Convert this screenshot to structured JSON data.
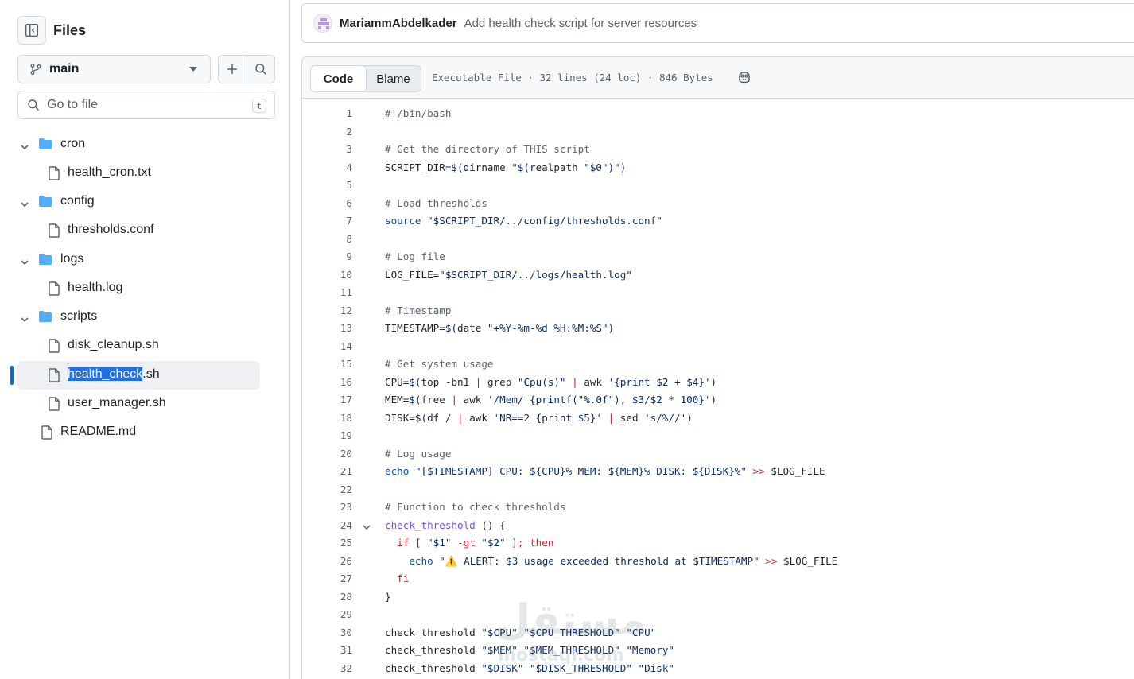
{
  "sidebar": {
    "title": "Files",
    "branch": "main",
    "search_placeholder": "Go to file",
    "search_shortcut": "t",
    "tree": [
      {
        "label": "cron",
        "type": "folder",
        "depth": 0,
        "expanded": true
      },
      {
        "label": "health_cron.txt",
        "type": "file",
        "depth": 1
      },
      {
        "label": "config",
        "type": "folder",
        "depth": 0,
        "expanded": true
      },
      {
        "label": "thresholds.conf",
        "type": "file",
        "depth": 1
      },
      {
        "label": "logs",
        "type": "folder",
        "depth": 0,
        "expanded": true
      },
      {
        "label": "health.log",
        "type": "file",
        "depth": 1
      },
      {
        "label": "scripts",
        "type": "folder",
        "depth": 0,
        "expanded": true
      },
      {
        "label": "disk_cleanup.sh",
        "type": "file",
        "depth": 1
      },
      {
        "label": "health_check.sh",
        "type": "file",
        "depth": 1,
        "active": true,
        "selected_part": "health_check",
        "rest_part": ".sh"
      },
      {
        "label": "user_manager.sh",
        "type": "file",
        "depth": 1
      },
      {
        "label": "README.md",
        "type": "file",
        "depth": 0
      }
    ]
  },
  "commit": {
    "author": "MariammAbdelkader",
    "message": "Add health check script for server resources"
  },
  "file": {
    "tabs": [
      "Code",
      "Blame"
    ],
    "active_tab": "Code",
    "meta": "Executable File · 32 lines (24 loc) · 846 Bytes",
    "copilot_icon": "copilot-icon",
    "lines": [
      [
        [
          "c-cm",
          "#!/bin/bash"
        ]
      ],
      [],
      [
        [
          "c-cm",
          "# Get the directory of THIS script"
        ]
      ],
      [
        [
          "",
          "SCRIPT_DIR="
        ],
        [
          "c-st",
          "$("
        ],
        [
          "",
          "dirname "
        ],
        [
          "c-st",
          "\"$("
        ],
        [
          "",
          "realpath "
        ],
        [
          "c-st",
          "\"$0\""
        ],
        [
          "c-st",
          ")\")"
        ]
      ],
      [],
      [
        [
          "c-cm",
          "# Load thresholds"
        ]
      ],
      [
        [
          "c-bi",
          "source"
        ],
        [
          "",
          " "
        ],
        [
          "c-st",
          "\"$SCRIPT_DIR/../config/thresholds.conf\""
        ]
      ],
      [],
      [
        [
          "c-cm",
          "# Log file"
        ]
      ],
      [
        [
          "",
          "LOG_FILE="
        ],
        [
          "c-st",
          "\"$SCRIPT_DIR/../logs/health.log\""
        ]
      ],
      [],
      [
        [
          "c-cm",
          "# Timestamp"
        ]
      ],
      [
        [
          "",
          "TIMESTAMP="
        ],
        [
          "c-st",
          "$("
        ],
        [
          "",
          "date "
        ],
        [
          "c-st",
          "\"+%Y-%m-%d %H:%M:%S\""
        ],
        [
          "c-st",
          ")"
        ]
      ],
      [],
      [
        [
          "c-cm",
          "# Get system usage"
        ]
      ],
      [
        [
          "",
          "CPU="
        ],
        [
          "c-st",
          "$("
        ],
        [
          "",
          "top -bn1 "
        ],
        [
          "c-kw",
          "|"
        ],
        [
          "",
          " grep "
        ],
        [
          "c-st",
          "\"Cpu(s)\""
        ],
        [
          "",
          " "
        ],
        [
          "c-kw",
          "|"
        ],
        [
          "",
          " awk "
        ],
        [
          "c-st",
          "'{print $2 + $4}'"
        ],
        [
          "c-st",
          ")"
        ]
      ],
      [
        [
          "",
          "MEM="
        ],
        [
          "c-st",
          "$("
        ],
        [
          "",
          "free "
        ],
        [
          "c-kw",
          "|"
        ],
        [
          "",
          " awk "
        ],
        [
          "c-st",
          "'/Mem/ {printf(\"%.0f\"), $3/$2 * 100}'"
        ],
        [
          "c-st",
          ")"
        ]
      ],
      [
        [
          "",
          "DISK="
        ],
        [
          "c-st",
          "$("
        ],
        [
          "",
          "df / "
        ],
        [
          "c-kw",
          "|"
        ],
        [
          "",
          " awk "
        ],
        [
          "c-st",
          "'NR==2 {print $5}'"
        ],
        [
          "",
          " "
        ],
        [
          "c-kw",
          "|"
        ],
        [
          "",
          " sed "
        ],
        [
          "c-st",
          "'s/%//'"
        ],
        [
          "c-st",
          ")"
        ]
      ],
      [],
      [
        [
          "c-cm",
          "# Log usage"
        ]
      ],
      [
        [
          "c-bi",
          "echo"
        ],
        [
          "",
          " "
        ],
        [
          "c-st",
          "\"[$TIMESTAMP] CPU: ${CPU}% MEM: ${MEM}% DISK: ${DISK}%\""
        ],
        [
          "",
          " "
        ],
        [
          "c-kw",
          ">>"
        ],
        [
          "",
          " $LOG_FILE"
        ]
      ],
      [],
      [
        [
          "c-cm",
          "# Function to check thresholds"
        ]
      ],
      [
        [
          "c-fn",
          "check_threshold"
        ],
        [
          "",
          " () {"
        ]
      ],
      [
        [
          "",
          "  "
        ],
        [
          "c-kw",
          "if"
        ],
        [
          "",
          " [ "
        ],
        [
          "c-st",
          "\"$1\""
        ],
        [
          "",
          " "
        ],
        [
          "c-kw",
          "-gt"
        ],
        [
          "",
          " "
        ],
        [
          "c-st",
          "\"$2\""
        ],
        [
          "",
          " ]"
        ],
        [
          "c-kw",
          ";"
        ],
        [
          "",
          " "
        ],
        [
          "c-kw",
          "then"
        ]
      ],
      [
        [
          "",
          "    "
        ],
        [
          "c-bi",
          "echo"
        ],
        [
          "",
          " "
        ],
        [
          "c-st",
          "\"⚠️ ALERT: $3 usage exceeded threshold at $TIMESTAMP\""
        ],
        [
          "",
          " "
        ],
        [
          "c-kw",
          ">>"
        ],
        [
          "",
          " $LOG_FILE"
        ]
      ],
      [
        [
          "",
          "  "
        ],
        [
          "c-kw",
          "fi"
        ]
      ],
      [
        [
          "",
          "}"
        ]
      ],
      [],
      [
        [
          "",
          "check_threshold "
        ],
        [
          "c-st",
          "\"$CPU\""
        ],
        [
          "",
          " "
        ],
        [
          "c-st",
          "\"$CPU_THRESHOLD\""
        ],
        [
          "",
          " "
        ],
        [
          "c-st",
          "\"CPU\""
        ]
      ],
      [
        [
          "",
          "check_threshold "
        ],
        [
          "c-st",
          "\"$MEM\""
        ],
        [
          "",
          " "
        ],
        [
          "c-st",
          "\"$MEM_THRESHOLD\""
        ],
        [
          "",
          " "
        ],
        [
          "c-st",
          "\"Memory\""
        ]
      ],
      [
        [
          "",
          "check_threshold "
        ],
        [
          "c-st",
          "\"$DISK\""
        ],
        [
          "",
          " "
        ],
        [
          "c-st",
          "\"$DISK_THRESHOLD\""
        ],
        [
          "",
          " "
        ],
        [
          "c-st",
          "\"Disk\""
        ]
      ]
    ],
    "foldable_line": 24
  },
  "watermark": {
    "arabic": "مستقل",
    "latin": "mostaql.com"
  }
}
